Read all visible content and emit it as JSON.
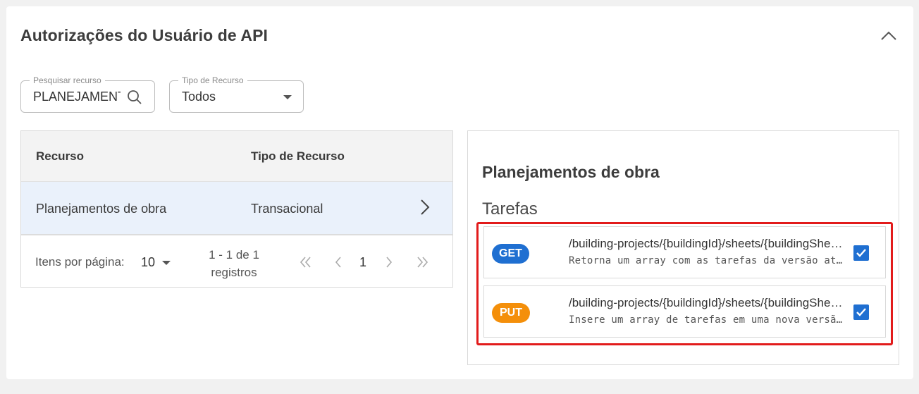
{
  "card": {
    "title": "Autorizações do Usuário de API",
    "collapse_icon": "chevron-up-icon"
  },
  "filters": {
    "search": {
      "label": "Pesquisar recurso",
      "value": "PLANEJAMENTO",
      "icon": "search-icon"
    },
    "resource_type": {
      "label": "Tipo de Recurso",
      "value": "Todos",
      "icon": "caret-down-icon"
    }
  },
  "table": {
    "columns": [
      "Recurso",
      "Tipo de Recurso"
    ],
    "rows": [
      {
        "resource": "Planejamentos de obra",
        "type": "Transacional",
        "icon": "chevron-right-icon"
      }
    ],
    "pagination": {
      "items_per_page_label": "Itens por página:",
      "items_per_page": "10",
      "range_line1": "1 - 1 de 1",
      "range_line2": "registros",
      "current_page": "1"
    }
  },
  "detail": {
    "title": "Planejamentos de obra",
    "section": "Tarefas",
    "endpoints": [
      {
        "method": "GET",
        "path": "/building-projects/{buildingId}/sheets/{buildingSheetId}/tasks",
        "description": "Retorna um array com as tarefas da versão atual da planilha",
        "checked": true
      },
      {
        "method": "PUT",
        "path": "/building-projects/{buildingId}/sheets/{buildingSheetId}/tasks",
        "description": "Insere um array de tarefas em uma nova versão da planilha",
        "checked": true
      }
    ]
  },
  "colors": {
    "get_badge": "#1f6fd1",
    "put_badge": "#f48f0a",
    "highlight_border": "#e21b1b",
    "selected_row": "#eaf1fb"
  }
}
